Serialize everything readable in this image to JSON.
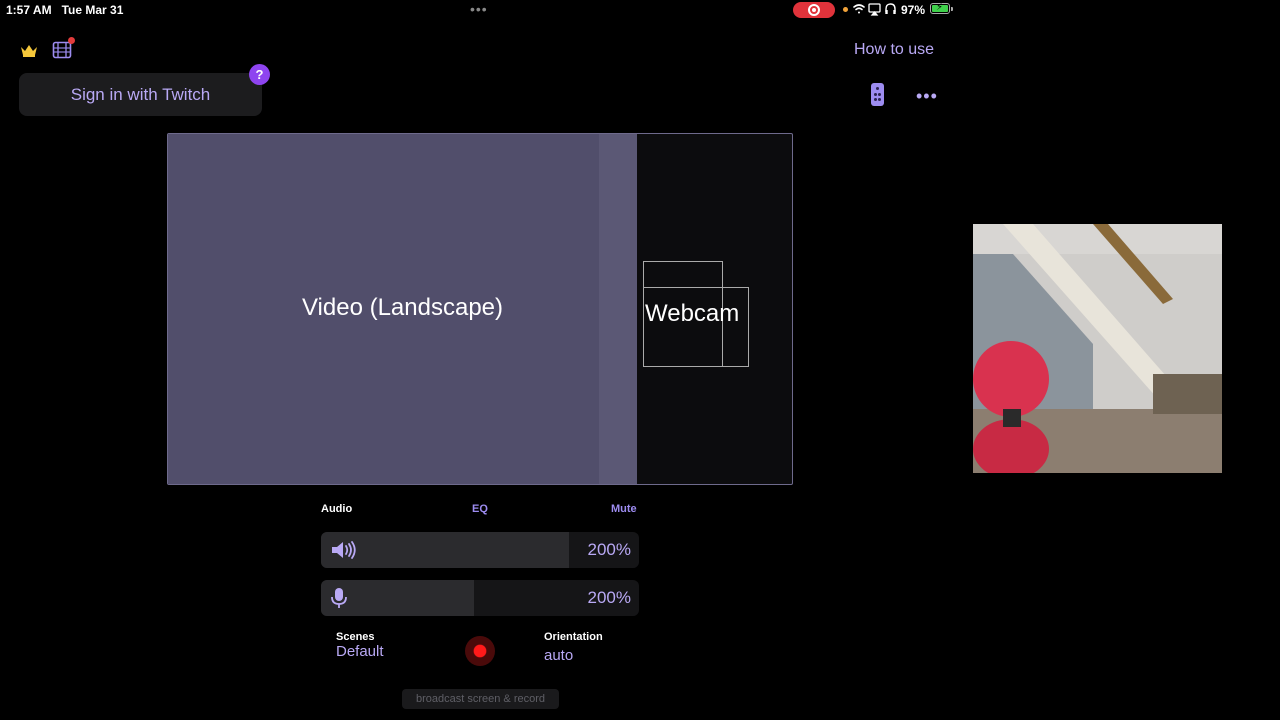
{
  "status_bar": {
    "time": "1:57 AM",
    "date": "Tue Mar 31",
    "multitask_dots": "•••",
    "battery_percent": "97%",
    "battery_level": 0.97,
    "icons": [
      "screen-recording-icon",
      "wifi-icon",
      "airplay-icon",
      "headphones-icon",
      "battery-charging-icon"
    ]
  },
  "header": {
    "crown_icon": "crown-icon",
    "film_icon": "film-icon",
    "signin_label": "Sign in with Twitch",
    "help_label": "?",
    "how_to_use_label": "How to use",
    "remote_icon": "remote-icon",
    "more_label": "•••"
  },
  "scene": {
    "video_label": "Video (Landscape)",
    "webcam_label": "Webcam"
  },
  "audio": {
    "audio_label": "Audio",
    "eq_label": "EQ",
    "mute_label": "Mute",
    "speaker_level": 0.78,
    "speaker_value": "200%",
    "mic_level": 0.48,
    "mic_value": "200%"
  },
  "controls": {
    "scenes_label": "Scenes",
    "scenes_value": "Default",
    "orientation_label": "Orientation",
    "orientation_value": "auto",
    "broadcast_label": "broadcast screen & record"
  },
  "colors": {
    "accent": "#b9a9f5",
    "accent_dark": "#9d8cf0",
    "help_badge": "#8e44f0",
    "record": "#ff1a1a",
    "video_area": "#514e6b"
  }
}
